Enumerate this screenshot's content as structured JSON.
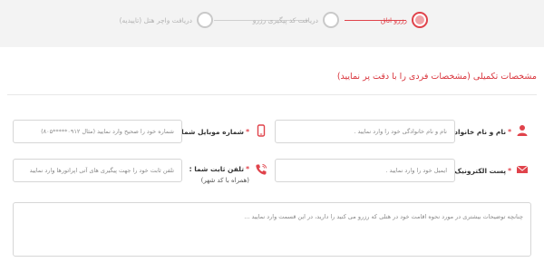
{
  "stepper": {
    "steps": [
      {
        "label": "رزرو اتاق",
        "active": true
      },
      {
        "label": "دریافت کد پیگیری رزرو",
        "active": false
      },
      {
        "label": "دریافت واچر هتل (تاییدیه)",
        "active": false
      }
    ]
  },
  "section": {
    "title": "مشخصات تکمیلی (مشخصات فردی را با دقت پر نمایید)"
  },
  "form": {
    "name": {
      "label": "نام و نام خانوادگی:",
      "required_mark": "*",
      "icon": "user-icon",
      "placeholder": "نام و نام خانوادگی خود را وارد نمایید ."
    },
    "mobile": {
      "label": "شماره موبایل شما :",
      "required_mark": "*",
      "icon": "mobile-phone-icon",
      "placeholder": "شماره خود را صحیح وارد نمایید (مثال ۰۹۱۲*****۸۰۵)"
    },
    "email": {
      "label": "پست الکترونیک :",
      "required_mark": "*",
      "icon": "envelope-icon",
      "placeholder": "ایمیل خود را وارد نمایید ."
    },
    "phone": {
      "label": "تلفن ثابت شما :",
      "sublabel": "(همراه با کد شهر)",
      "required_mark": "*",
      "icon": "phone-icon",
      "placeholder": "تلفن ثابت خود را جهت پیگیری های آتی اپراتورها وارد نمایید"
    },
    "notes": {
      "placeholder": "چنانچه توضیحات بیشتری در مورد نحوه اقامت خود در هتلی که رزرو می کنید را دارید، در این قسمت وارد نمایید ..."
    }
  },
  "colors": {
    "accent": "#e0434b",
    "stepper_bg": "#f3f3f3",
    "inactive": "#c9c9c9"
  }
}
